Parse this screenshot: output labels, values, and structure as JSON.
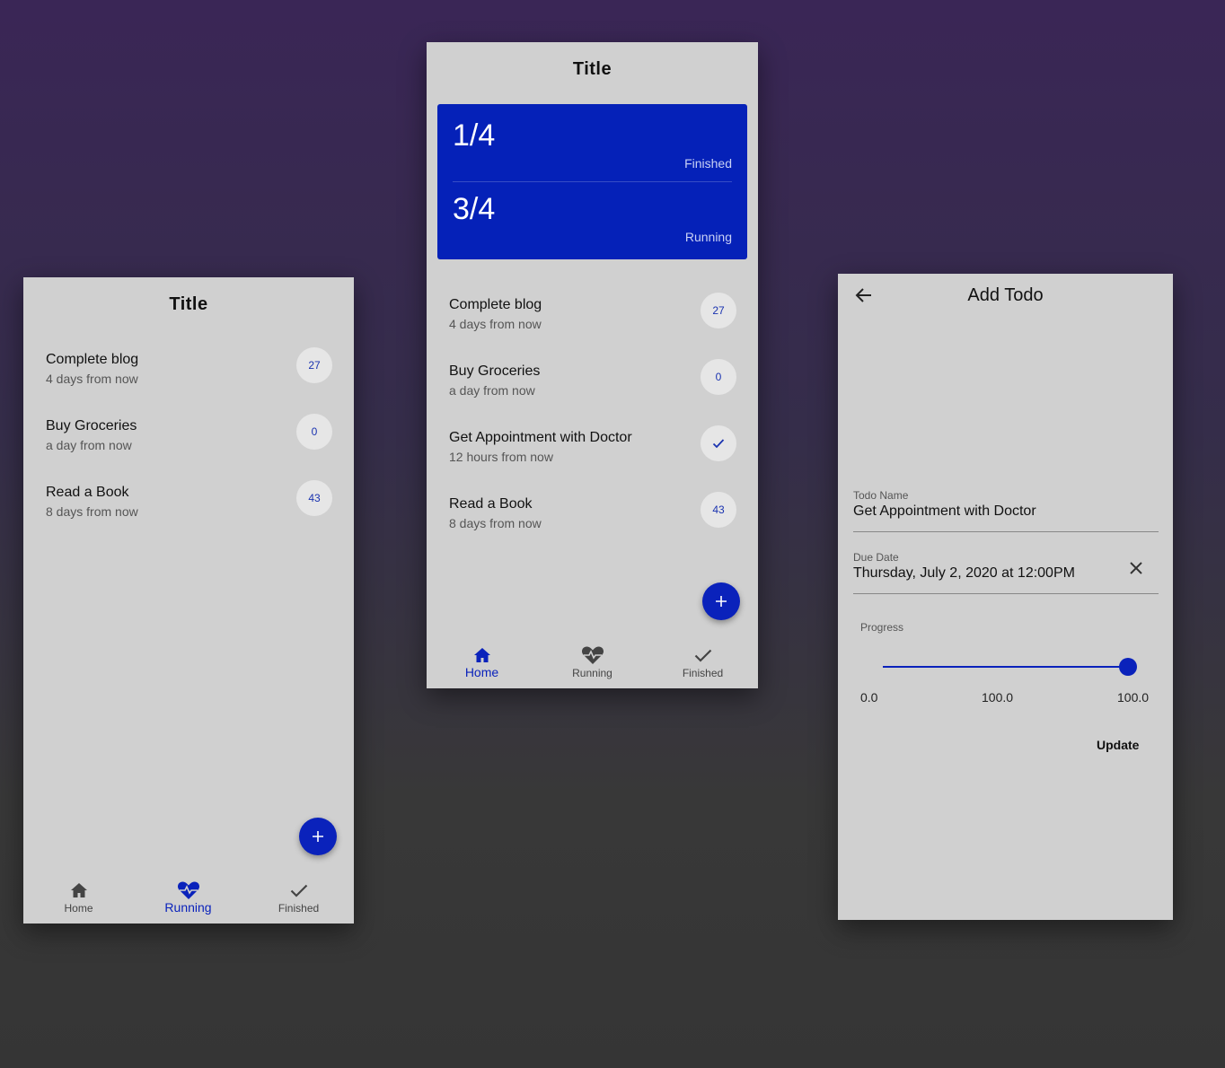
{
  "running_screen": {
    "title": "Title",
    "todos": [
      {
        "name": "Complete blog",
        "due": "4 days from now",
        "progress": "27"
      },
      {
        "name": "Buy Groceries",
        "due": "a day from now",
        "progress": "0"
      },
      {
        "name": "Read a Book",
        "due": "8 days from now",
        "progress": "43"
      }
    ],
    "fab_icon": "plus-icon",
    "nav": [
      {
        "label": "Home",
        "icon": "home-icon"
      },
      {
        "label": "Running",
        "icon": "heart-pulse-icon"
      },
      {
        "label": "Finished",
        "icon": "check-icon"
      }
    ],
    "active_tab": "Running"
  },
  "home_screen": {
    "title": "Title",
    "stats": {
      "finished_value": "1/4",
      "finished_label": "Finished",
      "running_value": "3/4",
      "running_label": "Running"
    },
    "todos": [
      {
        "name": "Complete blog",
        "due": "4 days from now",
        "progress": "27"
      },
      {
        "name": "Buy Groceries",
        "due": "a day from now",
        "progress": "0"
      },
      {
        "name": "Get Appointment with Doctor",
        "due": "12 hours from now",
        "progress": "",
        "icon": "check-icon"
      },
      {
        "name": "Read a Book",
        "due": "8 days from now",
        "progress": "43"
      }
    ],
    "fab_icon": "plus-icon",
    "nav": [
      {
        "label": "Home",
        "icon": "home-icon"
      },
      {
        "label": "Running",
        "icon": "heart-pulse-icon"
      },
      {
        "label": "Finished",
        "icon": "check-icon"
      }
    ],
    "active_tab": "Home"
  },
  "add_screen": {
    "title": "Add Todo",
    "back_icon": "arrow-left-icon",
    "name_label": "Todo Name",
    "name_value": "Get Appointment with Doctor",
    "due_label": "Due Date",
    "due_value": "Thursday, July 2, 2020 at 12:00PM",
    "clear_icon": "close-icon",
    "progress_label": "Progress",
    "progress_value": 1.0,
    "slider_min": "0.0",
    "slider_current": "100.0",
    "slider_max": "100.0",
    "update_label": "Update"
  },
  "colors": {
    "accent": "#0a22bb",
    "card": "#0521b8",
    "screen_bg": "#d0d0d0"
  }
}
